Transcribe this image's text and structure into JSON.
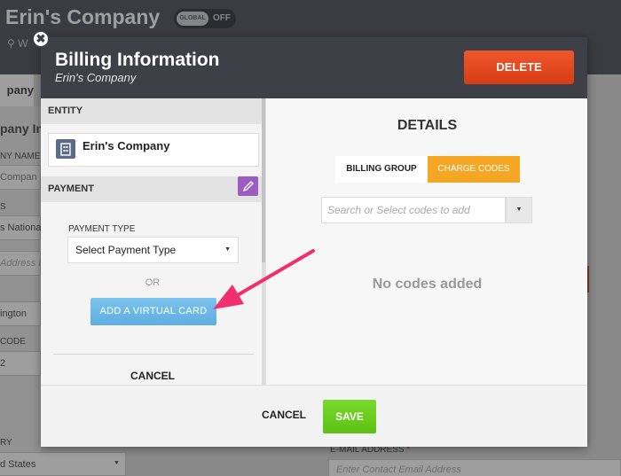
{
  "background": {
    "company_name": "Erin's Company",
    "toggle": {
      "knob_label": "GLOBAL",
      "state_label": "OFF"
    },
    "location_fragment": "W",
    "tab_fragment": "pany",
    "left_labels": [
      "pany Inf",
      "NY NAME",
      "Compan",
      "S",
      "s Nationa",
      "Address L",
      "ington",
      "CODE",
      "2",
      "RY",
      "d States"
    ],
    "email_label": "E-MAIL ADDRESS",
    "email_required_mark": "*",
    "email_placeholder": "Enter Contact Email Address"
  },
  "modal": {
    "title": "Billing Information",
    "subtitle": "Erin's Company",
    "delete_label": "DELETE",
    "close_glyph": "✖",
    "entity": {
      "section_label": "ENTITY",
      "name": "Erin's Company"
    },
    "payment": {
      "section_label": "PAYMENT",
      "type_label": "PAYMENT TYPE",
      "type_select_value": "Select Payment Type",
      "or_label": "OR",
      "virtual_card_label": "ADD A VIRTUAL CARD",
      "cancel_label": "CANCEL"
    },
    "details": {
      "title": "DETAILS",
      "tabs": [
        {
          "label": "BILLING GROUP",
          "active": false
        },
        {
          "label": "CHARGE CODES",
          "active": true
        }
      ],
      "codes_placeholder": "Search or Select codes to add",
      "empty_message": "No codes added"
    },
    "footer": {
      "cancel_label": "CANCEL",
      "save_label": "SAVE"
    }
  },
  "colors": {
    "header_bg": "#3d4047",
    "delete": "#e84a1f",
    "active_tab": "#f5a623",
    "virtual_card": "#6bb8e8",
    "save": "#6ccd1f",
    "edit": "#9c5cc0",
    "annotation_arrow": "#f0306e"
  }
}
